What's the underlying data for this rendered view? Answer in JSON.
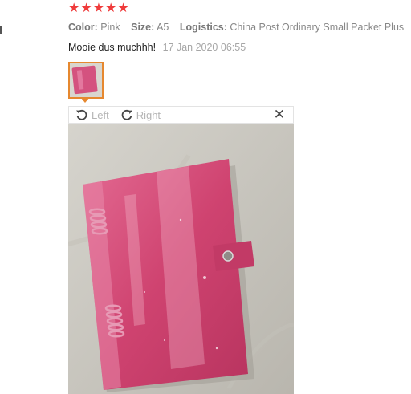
{
  "review": {
    "rating": 5,
    "color_label": "Color:",
    "color_value": "Pink",
    "size_label": "Size:",
    "size_value": "A5",
    "logistics_label": "Logistics:",
    "logistics_value": "China Post Ordinary Small Packet Plus",
    "comment": "Mooie dus muchhh!",
    "date": "17 Jan 2020 06:55"
  },
  "viewer": {
    "rotate_left_label": "Left",
    "rotate_right_label": "Right",
    "close_icon": "close-icon"
  },
  "colors": {
    "star": "#ef3b3b",
    "thumb_border": "#e6882f",
    "binder": "#d84a78"
  }
}
